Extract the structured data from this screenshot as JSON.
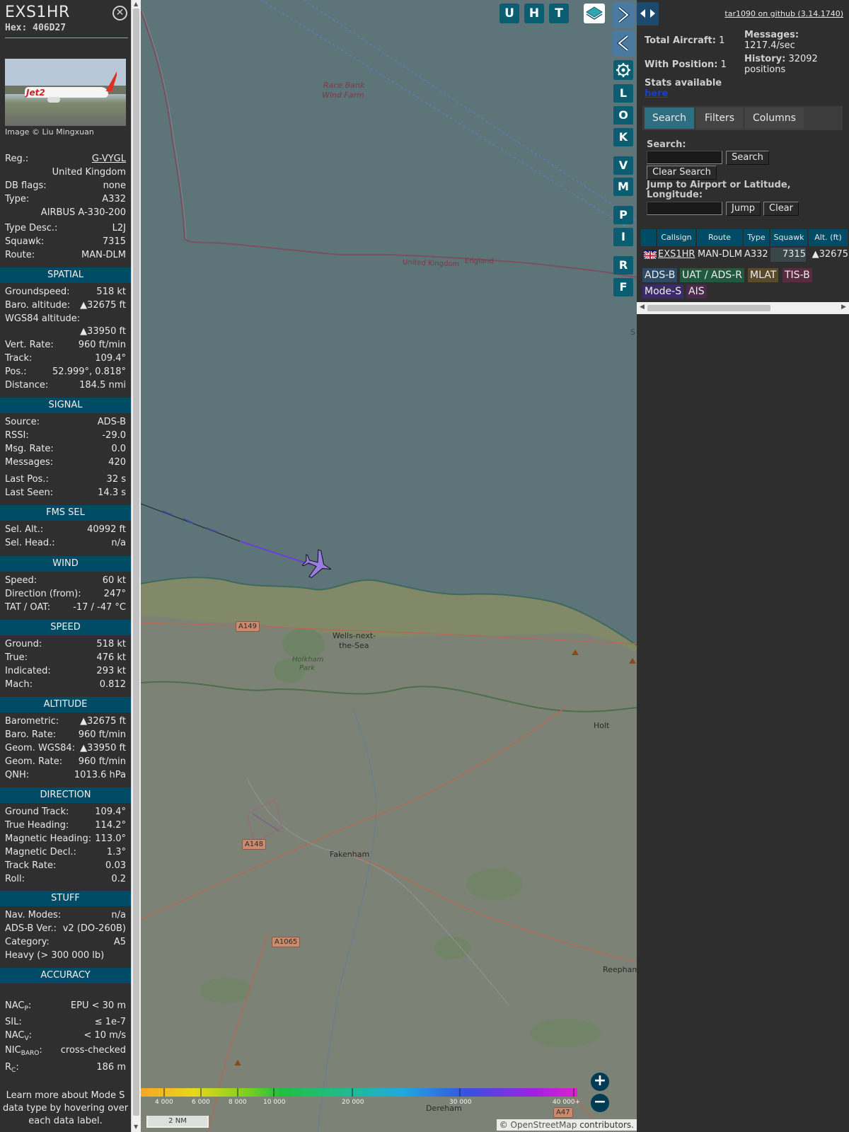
{
  "sidebar": {
    "callsign": "EXS1HR",
    "hex_label": "Hex:",
    "hex": "406D27",
    "photo_credit": "Image © Liu Mingxuan",
    "photo_livery": "Jet2",
    "info": [
      {
        "k": "Reg.:",
        "v": "G-VYGL"
      },
      {
        "k": "",
        "v": "United Kingdom"
      },
      {
        "k": "DB flags:",
        "v": "none"
      },
      {
        "k": "Type:",
        "v": "A332"
      },
      {
        "k": "",
        "v": "AIRBUS A-330-200"
      },
      {
        "k": "Type Desc.:",
        "v": "L2J"
      },
      {
        "k": "Squawk:",
        "v": "7315"
      },
      {
        "k": "Route:",
        "v": "MAN-DLM"
      }
    ],
    "sections": {
      "spatial": {
        "title": "SPATIAL",
        "rows": [
          {
            "k": "Groundspeed:",
            "v": "518 kt"
          },
          {
            "k": "Baro. altitude:",
            "v": "▲32675 ft"
          },
          {
            "k": "WGS84 altitude:",
            "v": ""
          },
          {
            "k": "",
            "v": "▲33950 ft"
          },
          {
            "k": "Vert. Rate:",
            "v": "960 ft/min"
          },
          {
            "k": "Track:",
            "v": "109.4°"
          },
          {
            "k": "Pos.:",
            "v": "52.999°, 0.818°"
          },
          {
            "k": "Distance:",
            "v": "184.5 nmi"
          }
        ]
      },
      "signal": {
        "title": "SIGNAL",
        "rows": [
          {
            "k": "Source:",
            "v": "ADS-B"
          },
          {
            "k": "RSSI:",
            "v": "-29.0"
          },
          {
            "k": "Msg. Rate:",
            "v": "0.0"
          },
          {
            "k": "Messages:",
            "v": "420"
          },
          {
            "k": "Last Pos.:",
            "v": "32 s"
          },
          {
            "k": "Last Seen:",
            "v": "14.3 s"
          }
        ]
      },
      "fms": {
        "title": "FMS SEL",
        "rows": [
          {
            "k": "Sel. Alt.:",
            "v": "40992 ft"
          },
          {
            "k": "Sel. Head.:",
            "v": "n/a"
          }
        ]
      },
      "wind": {
        "title": "WIND",
        "rows": [
          {
            "k": "Speed:",
            "v": "60 kt"
          },
          {
            "k": "Direction (from):",
            "v": "247°"
          },
          {
            "k": "TAT / OAT:",
            "v": "-17 / -47 °C"
          }
        ]
      },
      "speed": {
        "title": "SPEED",
        "rows": [
          {
            "k": "Ground:",
            "v": "518 kt"
          },
          {
            "k": "True:",
            "v": "476 kt"
          },
          {
            "k": "Indicated:",
            "v": "293 kt"
          },
          {
            "k": "Mach:",
            "v": "0.812"
          }
        ]
      },
      "altitude": {
        "title": "ALTITUDE",
        "rows": [
          {
            "k": "Barometric:",
            "v": "▲32675 ft"
          },
          {
            "k": "Baro. Rate:",
            "v": "960 ft/min"
          },
          {
            "k": "Geom. WGS84:",
            "v": "▲33950 ft"
          },
          {
            "k": "Geom. Rate:",
            "v": "960 ft/min"
          },
          {
            "k": "QNH:",
            "v": "1013.6 hPa"
          }
        ]
      },
      "direction": {
        "title": "DIRECTION",
        "rows": [
          {
            "k": "Ground Track:",
            "v": "109.4°"
          },
          {
            "k": "True Heading:",
            "v": "114.2°"
          },
          {
            "k": "Magnetic Heading:",
            "v": "113.0°"
          },
          {
            "k": "Magnetic Decl.:",
            "v": "1.3°"
          },
          {
            "k": "Track Rate:",
            "v": "0.03"
          },
          {
            "k": "Roll:",
            "v": "0.2"
          }
        ]
      },
      "stuff": {
        "title": "STUFF",
        "rows": [
          {
            "k": "Nav. Modes:",
            "v": "n/a"
          },
          {
            "k": "ADS-B Ver.:",
            "v": "v2 (DO-260B)"
          },
          {
            "k": "Category:",
            "v": "A5"
          },
          {
            "k": "Heavy (> 300 000 lb)",
            "v": ""
          }
        ]
      },
      "accuracy": {
        "title": "ACCURACY",
        "nacp_k": "NAC",
        "nacp_sub": "P",
        "nacp_v": "EPU < 30 m",
        "sil_k": "SIL:",
        "sil_v": "≤ 1e-7",
        "nacv_k": "NAC",
        "nacv_sub": "V",
        "nacv_v": "< 10 m/s",
        "nicb_k": "NIC",
        "nicb_sub": "BARO",
        "nicb_v": "cross-checked",
        "rc_k": "R",
        "rc_sub": "C",
        "rc_v": "186 m"
      }
    },
    "footer_note": "Learn more about Mode S data type by hovering over each data label."
  },
  "map": {
    "top_buttons": [
      "U",
      "H",
      "T"
    ],
    "side_buttons": [
      "L",
      "O",
      "K",
      "V",
      "M",
      "P",
      "I",
      "R",
      "F"
    ],
    "labels": {
      "wind_farm_1": "Race Bank",
      "wind_farm_2": "Wind Farm",
      "border_uk": "United Kingdom",
      "border_eng": "England",
      "wells_1": "Wells-next-",
      "wells_2": "the-Sea",
      "holkham_1": "Holkham",
      "holkham_2": "Park",
      "holt": "Holt",
      "fakenham": "Fakenham",
      "reepham": "Reepham",
      "dereham": "Dereham",
      "edge_s": "S"
    },
    "roads": {
      "a149": "A149",
      "a148": "A148",
      "a1065": "A1065",
      "a47": "A47"
    },
    "legend_labels": [
      "4 000",
      "6 000",
      "8 000",
      "10 000",
      "20 000",
      "30 000",
      "40 000+"
    ],
    "scale": "2 NM",
    "attribution_prefix": "©",
    "attribution_link": "OpenStreetMap",
    "attribution_suffix": "contributors."
  },
  "right": {
    "github_link": "tar1090 on github (3.14.1740)",
    "total_aircraft_label": "Total Aircraft:",
    "total_aircraft": "1",
    "with_position_label": "With Position:",
    "with_position": "1",
    "messages_label": "Messages:",
    "messages": "1217.4/sec",
    "history_label": "History:",
    "history": "32092",
    "history_unit": "positions",
    "stats_label": "Stats available",
    "stats_link": "here",
    "tabs": [
      "Search",
      "Filters",
      "Columns"
    ],
    "search_label": "Search:",
    "search_button": "Search",
    "clear_search_button": "Clear Search",
    "jump_label": "Jump to Airport or Latitude, Longitude:",
    "jump_button": "Jump",
    "clear_button": "Clear",
    "table_headers": [
      "",
      "Callsign",
      "Route",
      "Type",
      "Squawk",
      "Alt. (ft)"
    ],
    "table_row": {
      "callsign": "EXS1HR",
      "route": "MAN-DLM",
      "type": "A332",
      "squawk": "7315",
      "alt": "▲32675"
    },
    "chips": [
      "ADS-B",
      "UAT / ADS-R",
      "MLAT",
      "TIS-B",
      "Mode-S",
      "AIS"
    ]
  },
  "colors": {
    "section_header": "#004c66",
    "map_button": "#0b5e72",
    "active_tab": "#2f6e80",
    "aircraft_fill": "#9a7de0",
    "track_line": "#6a3fd8"
  }
}
